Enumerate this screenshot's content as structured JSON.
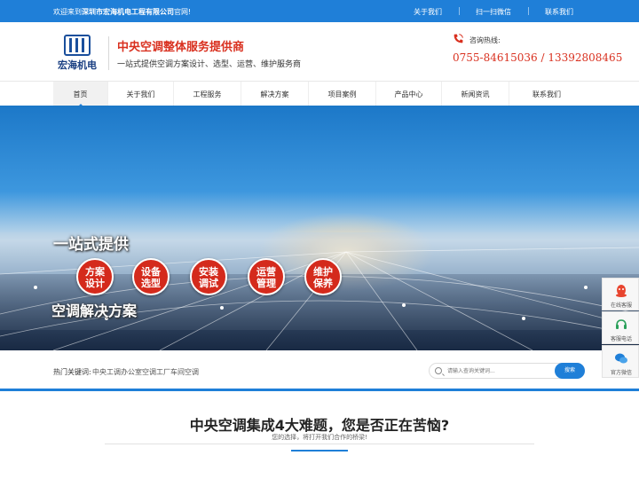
{
  "topbar": {
    "welcome_prefix": "欢迎来到",
    "company": "深圳市宏海机电工程有限公司",
    "welcome_suffix": "官网!",
    "links": [
      "关于我们",
      "扫一扫微信",
      "联系我们"
    ]
  },
  "header": {
    "logo_text": "宏海机电",
    "title": "中央空调整体服务提供商",
    "subtitle": "一站式提供空调方案设计、选型、运营、维护服务商",
    "phone_label": "咨询热线:",
    "phone_numbers": "0755-84615036 / 13392808465"
  },
  "nav": {
    "items": [
      "首页",
      "关于我们",
      "工程服务",
      "解决方案",
      "项目案例",
      "产品中心",
      "新闻资讯",
      "联系我们"
    ]
  },
  "banner": {
    "slogan_top": "一站式提供",
    "slogan_bottom": "空调解决方案",
    "circles": [
      {
        "line1": "方案",
        "line2": "设计"
      },
      {
        "line1": "设备",
        "line2": "选型"
      },
      {
        "line1": "安装",
        "line2": "调试"
      },
      {
        "line1": "运营",
        "line2": "管理"
      },
      {
        "line1": "维护",
        "line2": "保养"
      }
    ]
  },
  "search": {
    "hot_label": "热门关键词:",
    "hot_words": "中央工调办公室空调工厂车间空调",
    "placeholder": "请输入查询关键词...",
    "button": "搜索"
  },
  "section": {
    "title": "中央空调集成4大难题，您是否正在苦恼?",
    "subtitle": "您的选择，将打开我们合作的桥梁!"
  },
  "float": {
    "items": [
      "在线客服",
      "客服电话",
      "官方微信"
    ]
  },
  "colors": {
    "primary": "#1f7fd8",
    "accent_red": "#d9301f",
    "circle_red": "#d42a1c"
  }
}
